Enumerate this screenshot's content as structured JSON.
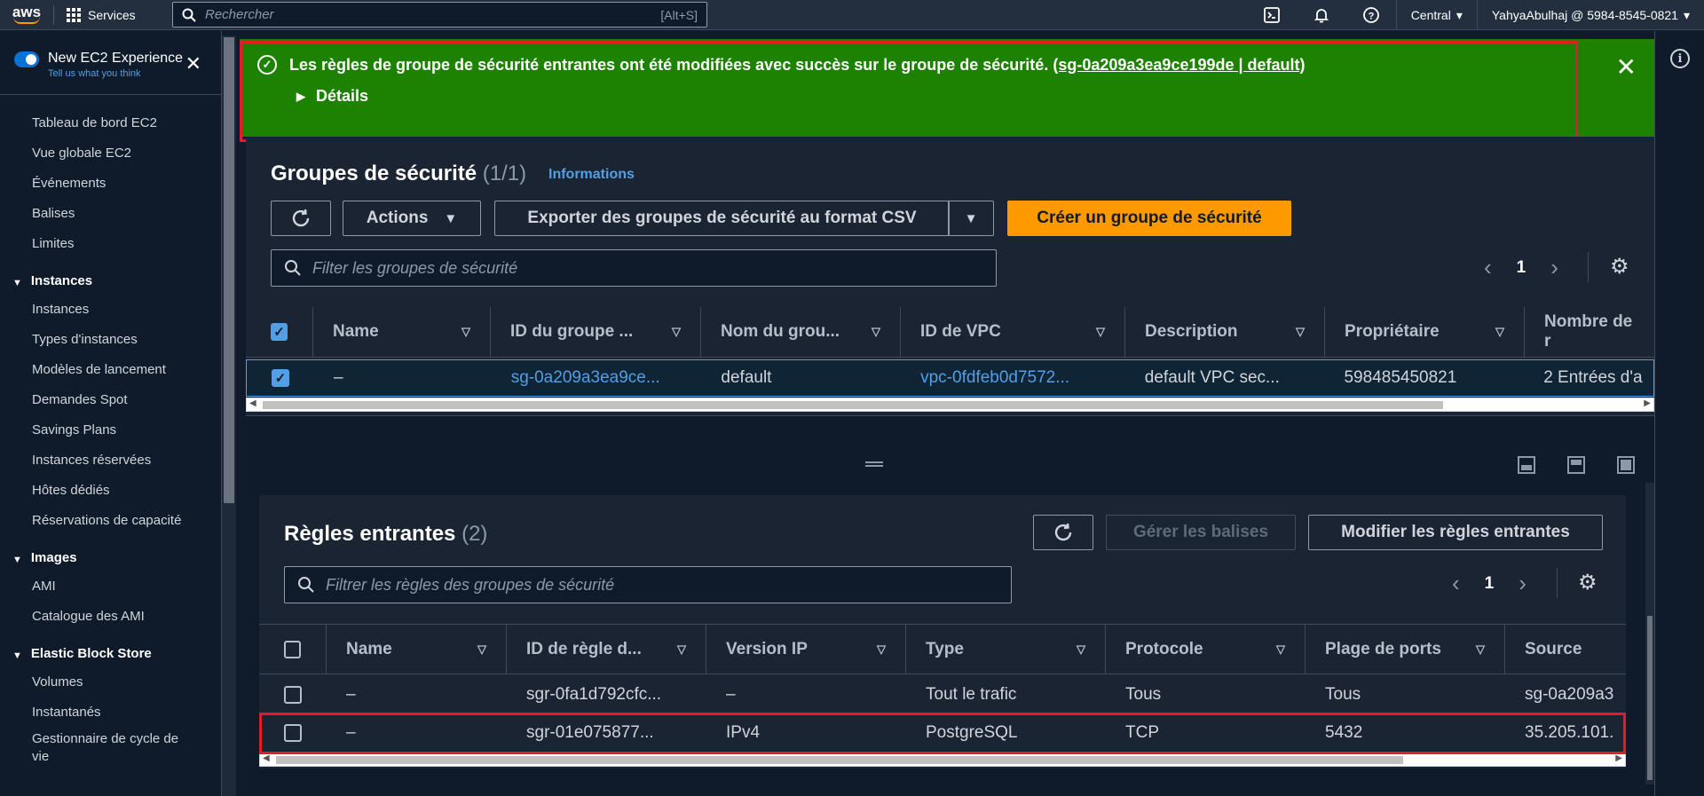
{
  "topnav": {
    "logo": "aws",
    "services": "Services",
    "search_placeholder": "Rechercher",
    "search_shortcut": "[Alt+S]",
    "region": "Central",
    "account": "YahyaAbulhaj @ 5984-8545-0821"
  },
  "sidebar": {
    "experience_label": "New EC2 Experience",
    "experience_link": "Tell us what you think",
    "top_items": [
      "Tableau de bord EC2",
      "Vue globale EC2",
      "Événements",
      "Balises",
      "Limites"
    ],
    "sections": [
      {
        "title": "Instances",
        "items": [
          "Instances",
          "Types d'instances",
          "Modèles de lancement",
          "Demandes Spot",
          "Savings Plans",
          "Instances réservées",
          "Hôtes dédiés",
          "Réservations de capacité"
        ]
      },
      {
        "title": "Images",
        "items": [
          "AMI",
          "Catalogue des AMI"
        ]
      },
      {
        "title": "Elastic Block Store",
        "items": [
          "Volumes",
          "Instantanés",
          "Gestionnaire de cycle de vie"
        ]
      }
    ]
  },
  "flash": {
    "message": "Les règles de groupe de sécurité entrantes ont été modifiées avec succès sur le groupe de sécurité.",
    "link": "(sg-0a209a3ea9ce199de | default)",
    "details": "Détails"
  },
  "security_groups": {
    "title": "Groupes de sécurité",
    "count": "(1/1)",
    "info": "Informations",
    "actions": "Actions",
    "export": "Exporter des groupes de sécurité au format CSV",
    "create": "Créer un groupe de sécurité",
    "filter_placeholder": "Filter les groupes de sécurité",
    "page": "1",
    "columns": [
      "Name",
      "ID du groupe ...",
      "Nom du grou...",
      "ID de VPC",
      "Description",
      "Propriétaire",
      "Nombre de r"
    ],
    "row": [
      "–",
      "sg-0a209a3ea9ce...",
      "default",
      "vpc-0fdfeb0d7572...",
      "default VPC sec...",
      "598485450821",
      "2 Entrées d'a"
    ]
  },
  "inbound_rules": {
    "title": "Règles entrantes",
    "count": "(2)",
    "manage_tags": "Gérer les balises",
    "edit": "Modifier les règles entrantes",
    "filter_placeholder": "Filtrer les règles des groupes de sécurité",
    "page": "1",
    "columns": [
      "Name",
      "ID de règle d...",
      "Version IP",
      "Type",
      "Protocole",
      "Plage de ports",
      "Source"
    ],
    "rows": [
      [
        "–",
        "sgr-0fa1d792cfc...",
        "–",
        "Tout le trafic",
        "Tous",
        "Tous",
        "sg-0a209a3"
      ],
      [
        "–",
        "sgr-01e075877...",
        "IPv4",
        "PostgreSQL",
        "TCP",
        "5432",
        "35.205.101."
      ]
    ]
  },
  "colors": {
    "flash_bg": "#1d8102",
    "primary_button": "#ff9900",
    "link": "#539fe5",
    "highlight_border": "#e41b2b"
  }
}
